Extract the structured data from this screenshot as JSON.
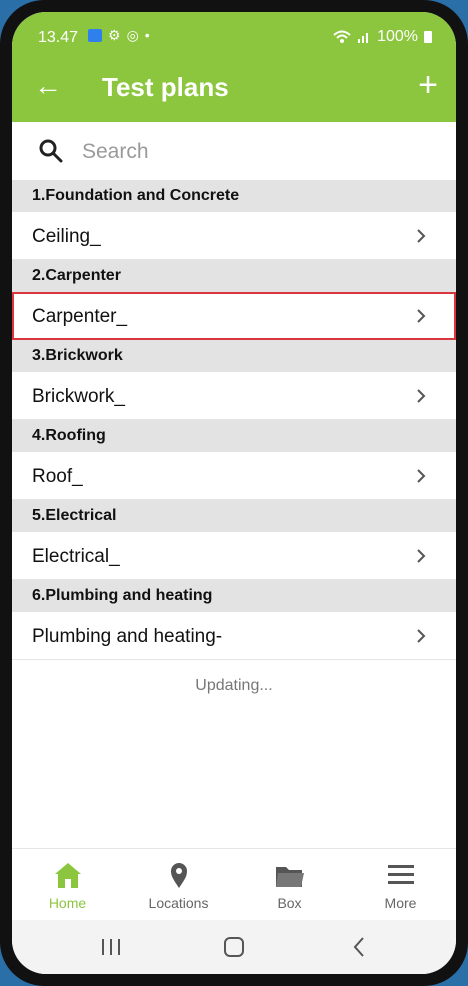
{
  "status_bar": {
    "time": "13.47",
    "battery": "100%",
    "icons": [
      "photos-icon",
      "gear-icon",
      "radio-icon",
      "dot-icon",
      "wifi-icon",
      "signal-icon",
      "battery-icon"
    ]
  },
  "header": {
    "title": "Test plans",
    "back_icon": "back-arrow-icon",
    "add_icon": "plus-icon"
  },
  "search": {
    "placeholder": "Search",
    "icon": "search-icon"
  },
  "sections": [
    {
      "title": "1.Foundation and Concrete",
      "item": "Ceiling_"
    },
    {
      "title": "2.Carpenter",
      "item": "Carpenter_"
    },
    {
      "title": "3.Brickwork",
      "item": "Brickwork_"
    },
    {
      "title": "4.Roofing",
      "item": "Roof_"
    },
    {
      "title": "5.Electrical",
      "item": "Electrical_"
    },
    {
      "title": "6.Plumbing and heating",
      "item": "Plumbing and heating-"
    }
  ],
  "updating_text": "Updating...",
  "bottom_nav": [
    {
      "label": "Home",
      "icon": "home-icon",
      "active": true
    },
    {
      "label": "Locations",
      "icon": "location-pin-icon",
      "active": false
    },
    {
      "label": "Box",
      "icon": "folder-icon",
      "active": false
    },
    {
      "label": "More",
      "icon": "menu-icon",
      "active": false
    }
  ],
  "colors": {
    "brand_green": "#8cc63f",
    "section_bg": "#e3e3e3",
    "highlight_red": "#d9363e"
  }
}
